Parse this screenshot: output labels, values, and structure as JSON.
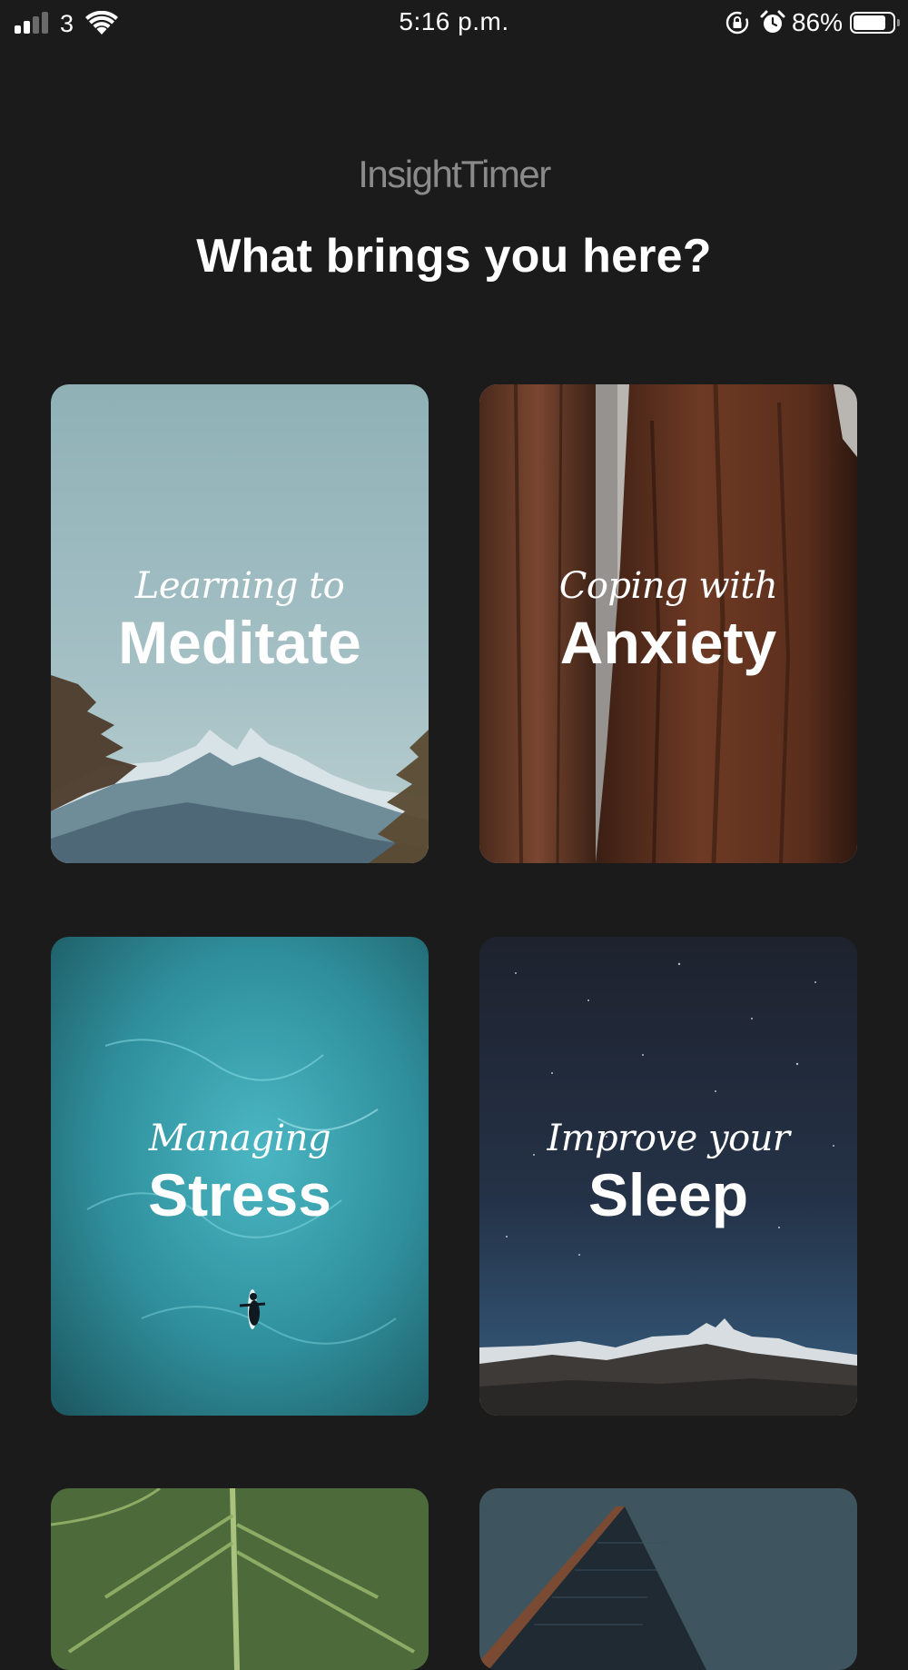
{
  "status_bar": {
    "carrier": "3",
    "time": "5:16 p.m.",
    "battery_percent": "86%",
    "battery_level": 0.86,
    "signal_bars": 2,
    "icons": [
      "signal-icon",
      "wifi-icon",
      "orientation-lock-icon",
      "alarm-icon",
      "battery-icon"
    ]
  },
  "header": {
    "brand": "InsightTimer",
    "title": "What brings you here?"
  },
  "cards": [
    {
      "small": "Learning to",
      "big": "Meditate"
    },
    {
      "small": "Coping with",
      "big": "Anxiety"
    },
    {
      "small": "Managing",
      "big": "Stress"
    },
    {
      "small": "Improve your",
      "big": "Sleep"
    }
  ],
  "colors": {
    "background": "#1b1b1c",
    "brand_text": "#8a8a8a",
    "text": "#ffffff"
  }
}
